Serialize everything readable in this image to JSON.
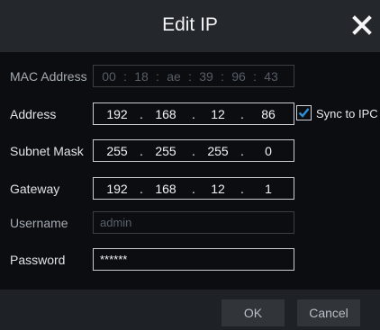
{
  "dialog": {
    "title": "Edit IP",
    "close_icon": "close-icon"
  },
  "fields": {
    "mac": {
      "label": "MAC Address",
      "segments": [
        "00",
        "18",
        "ae",
        "39",
        "96",
        "43"
      ],
      "separator": ":"
    },
    "address": {
      "label": "Address",
      "octets": [
        "192",
        "168",
        "12",
        "86"
      ],
      "separator": "."
    },
    "subnet": {
      "label": "Subnet Mask",
      "octets": [
        "255",
        "255",
        "255",
        "0"
      ],
      "separator": "."
    },
    "gateway": {
      "label": "Gateway",
      "octets": [
        "192",
        "168",
        "12",
        "1"
      ],
      "separator": "."
    },
    "username": {
      "label": "Username",
      "value": "admin"
    },
    "password": {
      "label": "Password",
      "value": "******"
    }
  },
  "sync": {
    "label": "Sync to IPC",
    "checked": true,
    "check_color": "#2f8fd8"
  },
  "buttons": {
    "ok": "OK",
    "cancel": "Cancel"
  }
}
